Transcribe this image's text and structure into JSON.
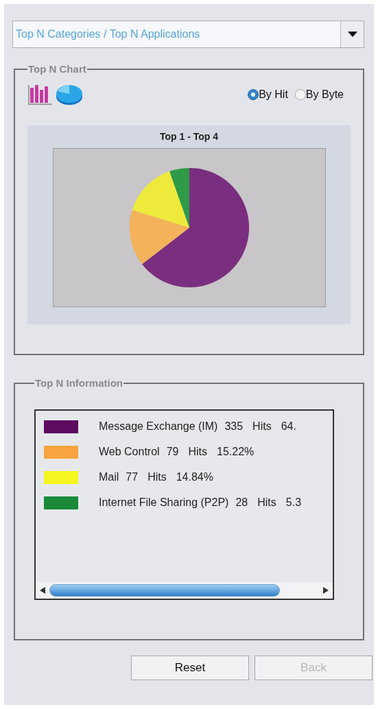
{
  "selector": {
    "value": "Top N Categories / Top N Applications"
  },
  "chart_section": {
    "title": "Top N Chart",
    "modes": [
      {
        "label": "By Hit",
        "selected": true
      },
      {
        "label": "By Byte",
        "selected": false
      }
    ],
    "chart_data": {
      "type": "pie",
      "title": "Top 1 - Top 4",
      "values": [
        64.55,
        15.22,
        14.84,
        5.39
      ],
      "colors": [
        "#7a2e7f",
        "#f4b25a",
        "#eeea3c",
        "#2f9a48"
      ]
    }
  },
  "info_section": {
    "title": "Top N Information",
    "rows": [
      {
        "color": "#5e0a5e",
        "name": "Message Exchange (IM)",
        "count": "335",
        "unit": "Hits",
        "percent": "64."
      },
      {
        "color": "#f7a440",
        "name": "Web Control",
        "count": "79",
        "unit": "Hits",
        "percent": "15.22%"
      },
      {
        "color": "#f5f520",
        "name": "Mail",
        "count": "77",
        "unit": "Hits",
        "percent": "14.84%"
      },
      {
        "color": "#1a8a3a",
        "name": "Internet File Sharing (P2P)",
        "count": "28",
        "unit": "Hits",
        "percent": "5.3"
      }
    ]
  },
  "buttons": [
    {
      "label": "Reset",
      "disabled": false
    },
    {
      "label": "Back",
      "disabled": true
    }
  ]
}
